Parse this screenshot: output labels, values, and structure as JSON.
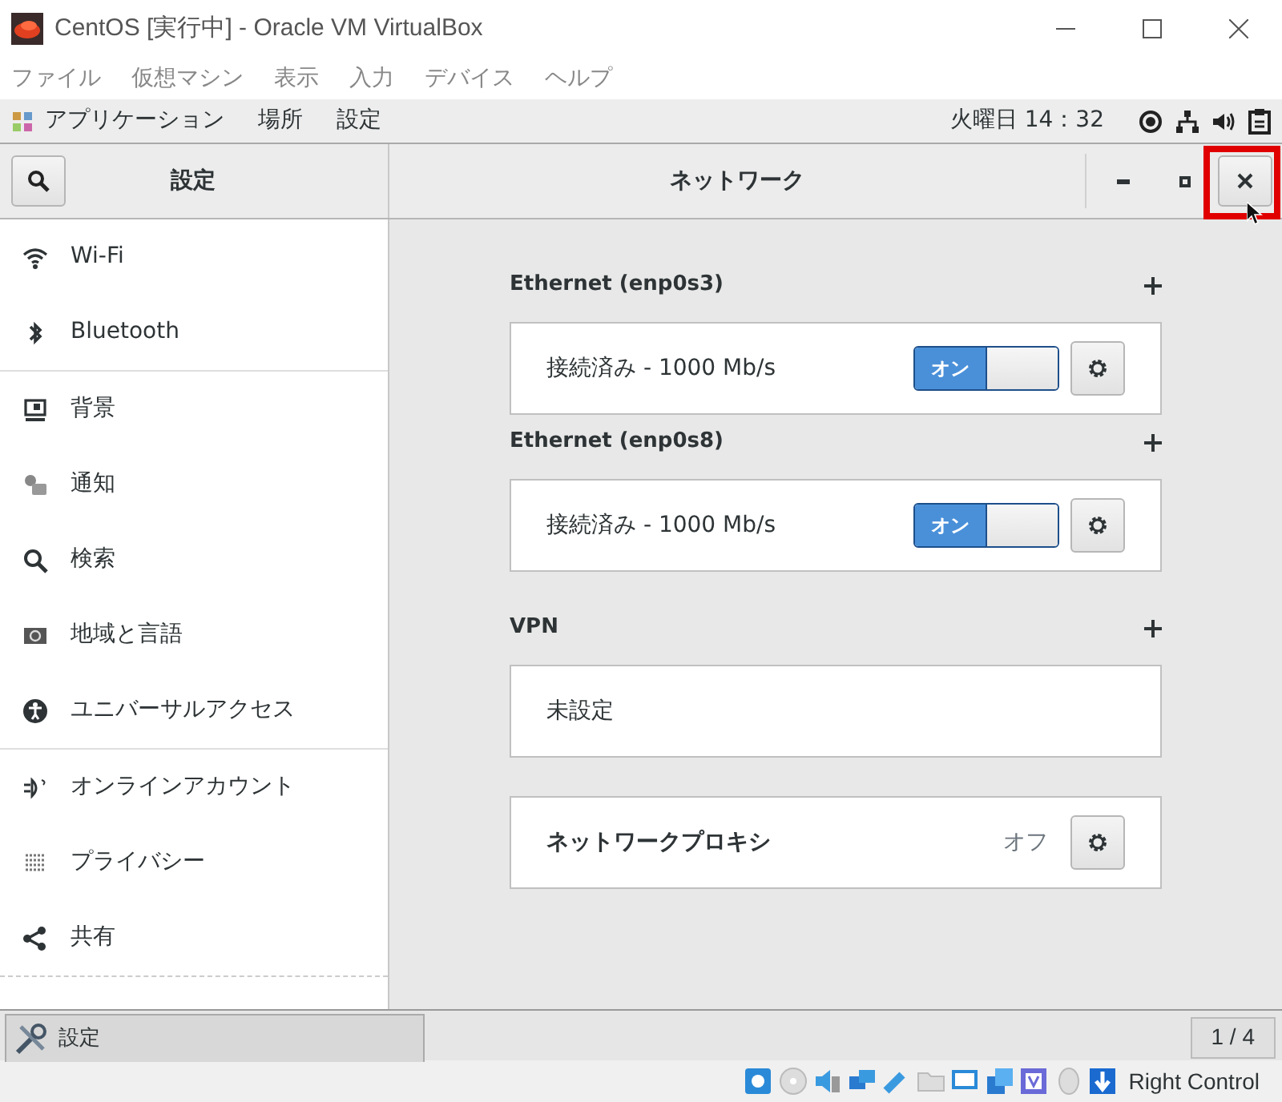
{
  "window": {
    "title": "CentOS [実行中] - Oracle VM VirtualBox"
  },
  "menu": [
    "ファイル",
    "仮想マシン",
    "表示",
    "入力",
    "デバイス",
    "ヘルプ"
  ],
  "top_bar": {
    "applications": "アプリケーション",
    "places": "場所",
    "settings": "設定",
    "clock": "火曜日 14：32"
  },
  "header": {
    "sidebar_title": "設定",
    "page_title": "ネットワーク",
    "close_highlighted": true
  },
  "sidebar": {
    "groups": [
      [
        {
          "label": "Wi-Fi"
        },
        {
          "label": "Bluetooth"
        }
      ],
      [
        {
          "label": "背景"
        },
        {
          "label": "通知"
        },
        {
          "label": "検索"
        },
        {
          "label": "地域と言語"
        },
        {
          "label": "ユニバーサルアクセス"
        }
      ],
      [
        {
          "label": "オンラインアカウント"
        },
        {
          "label": "プライバシー"
        },
        {
          "label": "共有"
        }
      ]
    ]
  },
  "sections": [
    {
      "kind": "device",
      "title": "Ethernet (enp0s3)",
      "status": "接続済み - 1000 Mb/s",
      "switch": {
        "on": true,
        "label": "オン"
      }
    },
    {
      "kind": "device",
      "title": "Ethernet (enp0s8)",
      "status": "接続済み - 1000 Mb/s",
      "switch": {
        "on": true,
        "label": "オン"
      }
    },
    {
      "kind": "vpn",
      "title": "VPN",
      "empty": "未設定"
    },
    {
      "kind": "proxy",
      "label": "ネットワークプロキシ",
      "value": "オフ"
    }
  ],
  "taskbar": {
    "item": "設定",
    "pager": "1 / 4"
  },
  "status_bar": {
    "host_key": "Right Control"
  }
}
